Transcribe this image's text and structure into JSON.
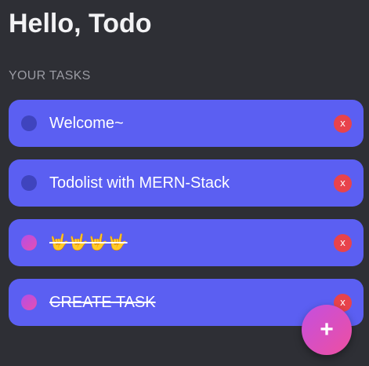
{
  "header": {
    "title": "Hello, Todo",
    "section_label": "YOUR TASKS"
  },
  "tasks": [
    {
      "text": "Welcome~",
      "completed": false,
      "delete_label": "x"
    },
    {
      "text": "Todolist with MERN-Stack",
      "completed": false,
      "delete_label": "x"
    },
    {
      "text": "🤟🤟🤟🤟",
      "completed": true,
      "delete_label": "x"
    },
    {
      "text": "CREATE TASK",
      "completed": true,
      "delete_label": "x"
    }
  ],
  "fab": {
    "label": "+",
    "icon": "plus-icon"
  },
  "colors": {
    "background": "#2e2f35",
    "task_card": "#5b5ff2",
    "check_open": "#3f44be",
    "delete": "#e8434b",
    "accent_gradient_start": "#c44fe0",
    "accent_gradient_end": "#ee4fa0"
  }
}
